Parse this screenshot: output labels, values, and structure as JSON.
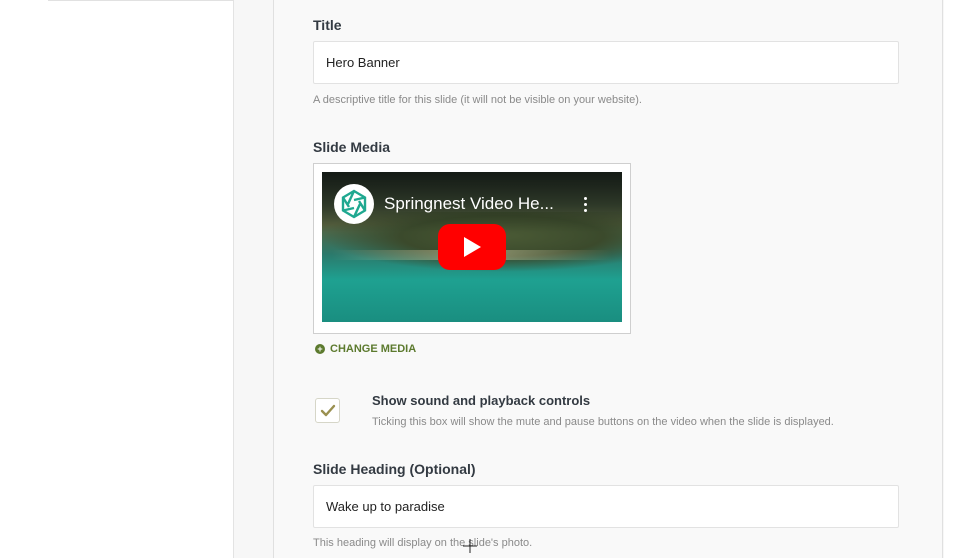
{
  "form": {
    "title": {
      "label": "Title",
      "value": "Hero Banner",
      "help": "A descriptive title for this slide (it will not be visible on your website)."
    },
    "slide_media": {
      "label": "Slide Media",
      "video_title": "Springnest Video He...",
      "change_media_label": "CHANGE MEDIA"
    },
    "controls": {
      "checked": true,
      "label": "Show sound and playback controls",
      "help": "Ticking this box will show the mute and pause buttons on the video when the slide is displayed."
    },
    "slide_heading": {
      "label": "Slide Heading (Optional)",
      "value": "Wake up to paradise",
      "help": "This heading will display on the slide's photo."
    }
  },
  "colors": {
    "accent_green": "#5c7a2e",
    "youtube_red": "#ff0000"
  },
  "icons": {
    "channel_logo": "springnest-logo-icon",
    "play": "play-icon",
    "more": "kebab-menu-icon",
    "add": "plus-circle-icon",
    "check": "checkmark-icon",
    "cursor": "crosshair-cursor-icon"
  }
}
